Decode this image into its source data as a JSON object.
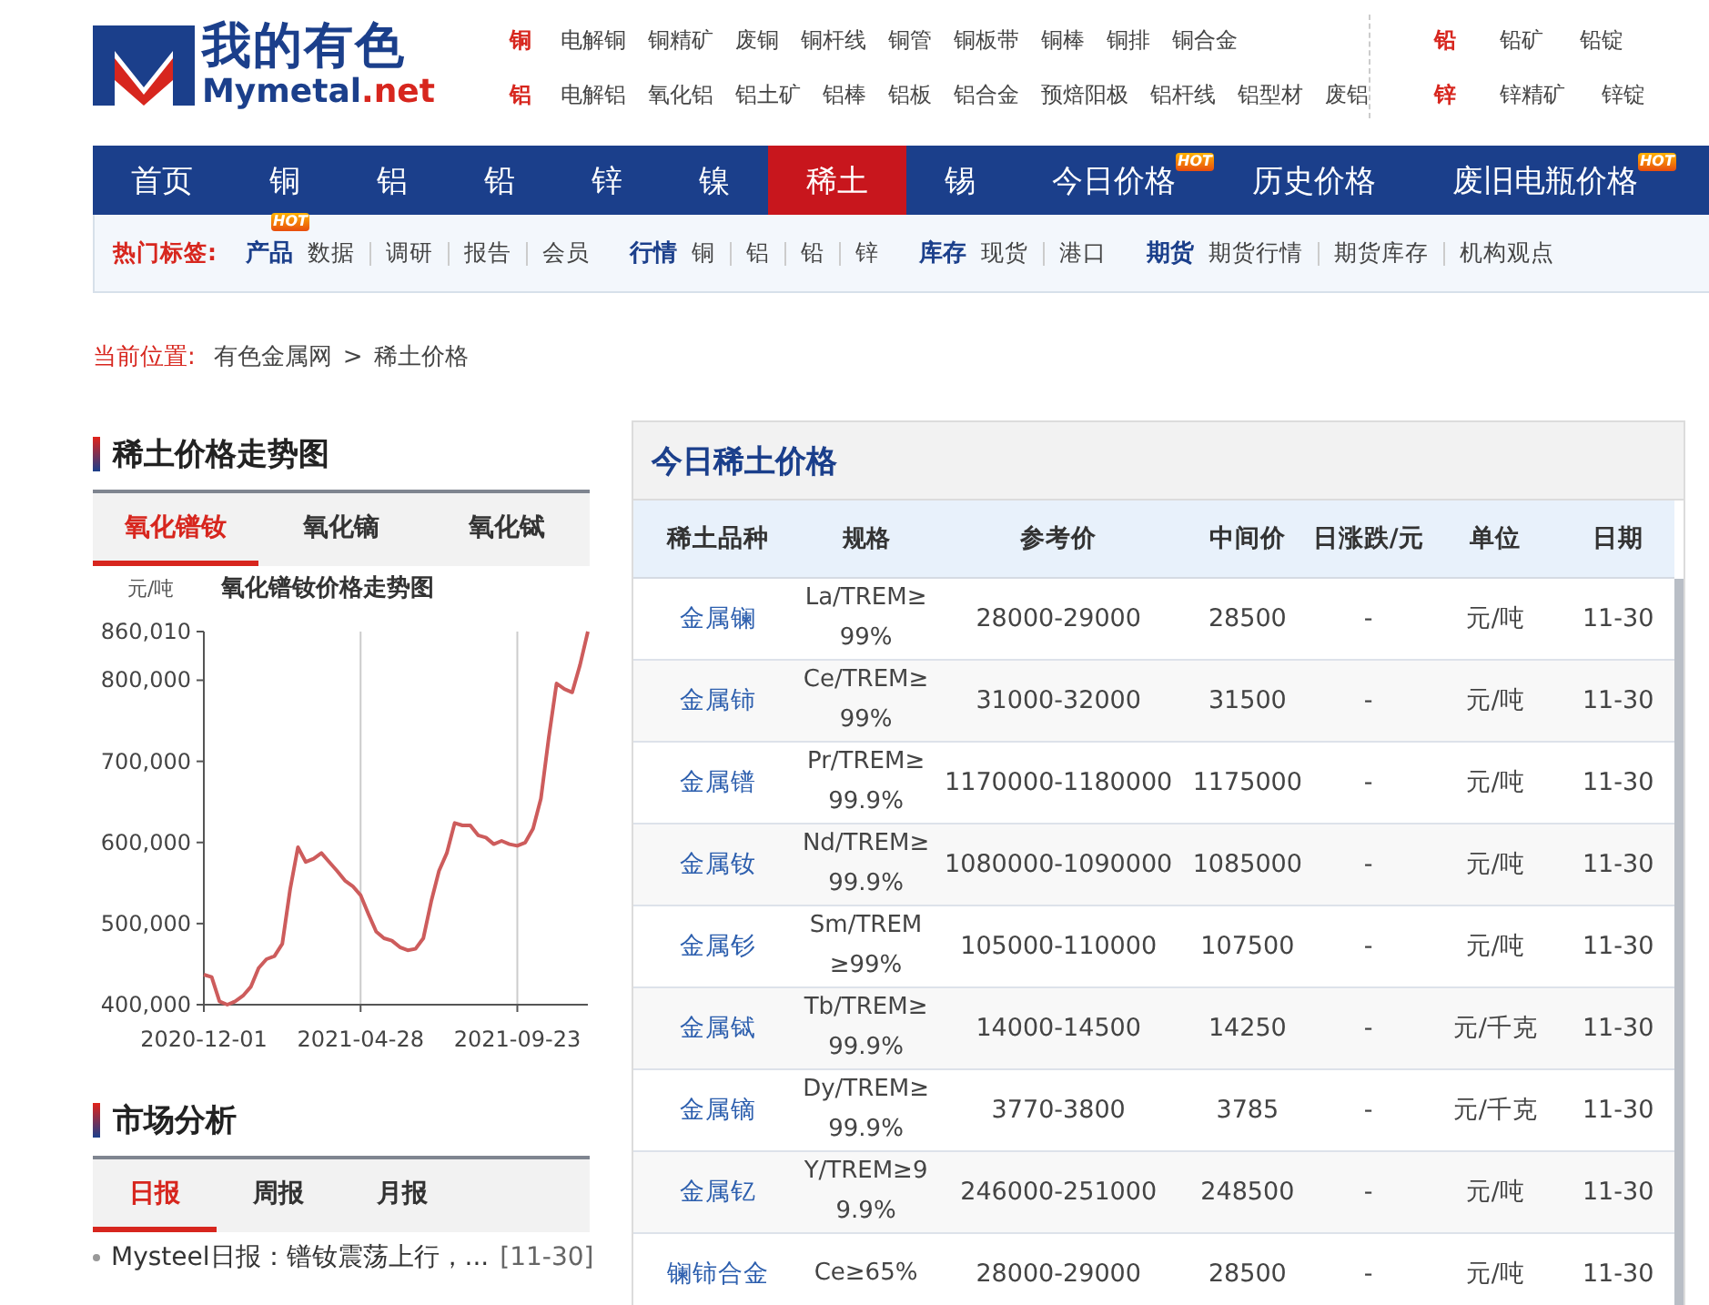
{
  "logo": {
    "cn": "我的有色",
    "en": "Mymetal",
    "en_suffix": ".net"
  },
  "header_links": [
    {
      "rows": [
        {
          "metal": "铜",
          "items": [
            "电解铜",
            "铜精矿",
            "废铜",
            "铜杆线",
            "铜管",
            "铜板带",
            "铜棒",
            "铜排",
            "铜合金"
          ]
        },
        {
          "metal": "铝",
          "items": [
            "电解铝",
            "氧化铝",
            "铝土矿",
            "铝棒",
            "铝板",
            "铝合金",
            "预焙阳极",
            "铝杆线",
            "铝型材",
            "废铝"
          ]
        }
      ]
    },
    {
      "rows": [
        {
          "metal": "铅",
          "items": [
            "铅矿",
            "铅锭"
          ]
        },
        {
          "metal": "锌",
          "items": [
            "锌精矿",
            "锌锭"
          ]
        }
      ]
    }
  ],
  "nav": [
    {
      "label": "首页",
      "selected": false
    },
    {
      "label": "铜",
      "selected": false
    },
    {
      "label": "铝",
      "selected": false
    },
    {
      "label": "铅",
      "selected": false
    },
    {
      "label": "锌",
      "selected": false
    },
    {
      "label": "镍",
      "selected": false
    },
    {
      "label": "稀土",
      "selected": true
    },
    {
      "label": "锡",
      "selected": false
    },
    {
      "label": "今日价格",
      "selected": false,
      "badge": "HOT"
    },
    {
      "label": "历史价格",
      "selected": false
    },
    {
      "label": "废旧电瓶价格",
      "selected": false,
      "badge": "HOT"
    }
  ],
  "hot_tags": {
    "label": "热门标签:",
    "groups": [
      {
        "title": "产品",
        "badge": "HOT",
        "items": [
          "数据",
          "调研",
          "报告",
          "会员"
        ]
      },
      {
        "title": "行情",
        "items": [
          "铜",
          "铝",
          "铅",
          "锌"
        ]
      },
      {
        "title": "库存",
        "items": [
          "现货",
          "港口"
        ]
      },
      {
        "title": "期货",
        "items": [
          "期货行情",
          "期货库存",
          "机构观点"
        ]
      }
    ]
  },
  "breadcrumb": {
    "label": "当前位置:",
    "items": [
      "有色金属网",
      "稀土价格"
    ],
    "separator": ">"
  },
  "trend": {
    "heading": "稀土价格走势图",
    "tabs": [
      {
        "label": "氧化镨钕",
        "selected": true
      },
      {
        "label": "氧化镝",
        "selected": false
      },
      {
        "label": "氧化铽",
        "selected": false
      }
    ],
    "chart_data": {
      "type": "line",
      "title": "氧化镨钕价格走势图",
      "ylabel": "元/吨",
      "categories": [
        "2020-12-01",
        null,
        null,
        null,
        null,
        null,
        null,
        null,
        null,
        null,
        null,
        null,
        null,
        null,
        null,
        null,
        null,
        null,
        null,
        null,
        "2021-04-28",
        null,
        null,
        null,
        null,
        null,
        null,
        null,
        null,
        null,
        null,
        null,
        null,
        null,
        null,
        null,
        null,
        null,
        null,
        null,
        "2021-09-23",
        null,
        null,
        null,
        null,
        null,
        null,
        null,
        null,
        null
      ],
      "series": [
        {
          "color": "#cd5c5c",
          "values": [
            437000,
            434000,
            404000,
            400000,
            404000,
            411000,
            422000,
            445000,
            456000,
            460000,
            475000,
            542000,
            594000,
            576000,
            580000,
            587000,
            576000,
            565000,
            553000,
            546000,
            535000,
            512000,
            490000,
            482000,
            479000,
            471000,
            467000,
            469000,
            482000,
            527000,
            565000,
            587000,
            624000,
            621000,
            621000,
            609000,
            606000,
            598000,
            602000,
            598000,
            596000,
            600000,
            617000,
            654000,
            729000,
            796000,
            789000,
            785000,
            819000,
            860010
          ]
        }
      ],
      "ylim": [
        400000,
        860010
      ],
      "yticks": [
        {
          "value": 400000,
          "label": "400,000"
        },
        {
          "value": 500000,
          "label": "500,000"
        },
        {
          "value": 600000,
          "label": "600,000"
        },
        {
          "value": 700000,
          "label": "700,000"
        },
        {
          "value": 800000,
          "label": "800,000"
        },
        {
          "value": 860010,
          "label": "860,010"
        }
      ]
    }
  },
  "analysis": {
    "heading": "市场分析",
    "tabs": [
      {
        "label": "日报",
        "selected": true
      },
      {
        "label": "周报",
        "selected": false
      },
      {
        "label": "月报",
        "selected": false
      }
    ],
    "items": [
      {
        "title": "Mysteel日报：镨钕震荡上行，...",
        "date": "[11-30]"
      }
    ]
  },
  "prices": {
    "title": "今日稀土价格",
    "columns": [
      "稀土品种",
      "规格",
      "参考价",
      "中间价",
      "日涨跌/元",
      "单位",
      "日期"
    ],
    "rows": [
      [
        "金属镧",
        "La/TREM≥99%",
        "28000-29000",
        "28500",
        "-",
        "元/吨",
        "11-30"
      ],
      [
        "金属铈",
        "Ce/TREM≥99%",
        "31000-32000",
        "31500",
        "-",
        "元/吨",
        "11-30"
      ],
      [
        "金属镨",
        "Pr/TREM≥99.9%",
        "1170000-1180000",
        "1175000",
        "-",
        "元/吨",
        "11-30"
      ],
      [
        "金属钕",
        "Nd/TREM≥99.9%",
        "1080000-1090000",
        "1085000",
        "-",
        "元/吨",
        "11-30"
      ],
      [
        "金属钐",
        "Sm/TREM≥99%",
        "105000-110000",
        "107500",
        "-",
        "元/吨",
        "11-30"
      ],
      [
        "金属铽",
        "Tb/TREM≥99.9%",
        "14000-14500",
        "14250",
        "-",
        "元/千克",
        "11-30"
      ],
      [
        "金属镝",
        "Dy/TREM≥99.9%",
        "3770-3800",
        "3785",
        "-",
        "元/千克",
        "11-30"
      ],
      [
        "金属钇",
        "Y/TREM≥99.9%",
        "246000-251000",
        "248500",
        "-",
        "元/吨",
        "11-30"
      ],
      [
        "镧铈合金",
        "Ce≥65%",
        "28000-29000",
        "28500",
        "-",
        "元/吨",
        "11-30"
      ]
    ]
  }
}
